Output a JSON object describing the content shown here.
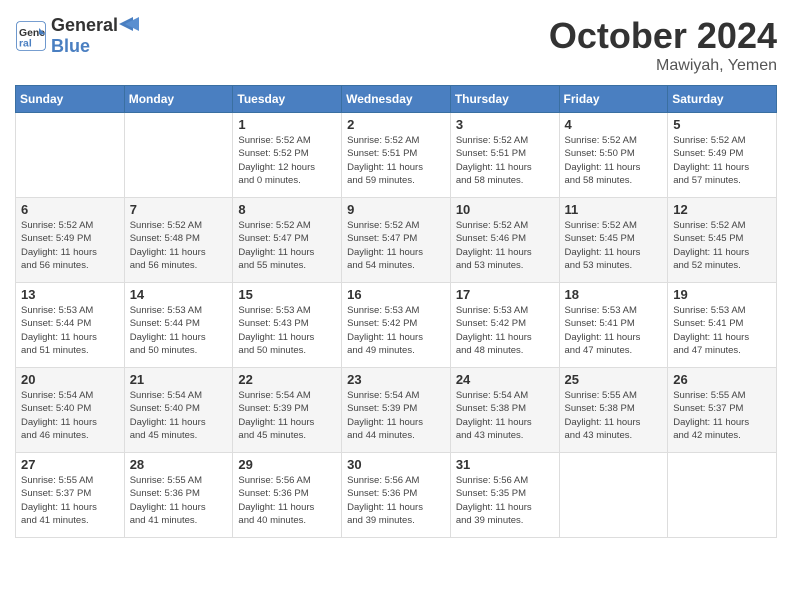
{
  "header": {
    "logo_line1": "General",
    "logo_line2": "Blue",
    "month_title": "October 2024",
    "location": "Mawiyah, Yemen"
  },
  "days_of_week": [
    "Sunday",
    "Monday",
    "Tuesday",
    "Wednesday",
    "Thursday",
    "Friday",
    "Saturday"
  ],
  "weeks": [
    [
      {
        "day": "",
        "info": ""
      },
      {
        "day": "",
        "info": ""
      },
      {
        "day": "1",
        "info": "Sunrise: 5:52 AM\nSunset: 5:52 PM\nDaylight: 12 hours\nand 0 minutes."
      },
      {
        "day": "2",
        "info": "Sunrise: 5:52 AM\nSunset: 5:51 PM\nDaylight: 11 hours\nand 59 minutes."
      },
      {
        "day": "3",
        "info": "Sunrise: 5:52 AM\nSunset: 5:51 PM\nDaylight: 11 hours\nand 58 minutes."
      },
      {
        "day": "4",
        "info": "Sunrise: 5:52 AM\nSunset: 5:50 PM\nDaylight: 11 hours\nand 58 minutes."
      },
      {
        "day": "5",
        "info": "Sunrise: 5:52 AM\nSunset: 5:49 PM\nDaylight: 11 hours\nand 57 minutes."
      }
    ],
    [
      {
        "day": "6",
        "info": "Sunrise: 5:52 AM\nSunset: 5:49 PM\nDaylight: 11 hours\nand 56 minutes."
      },
      {
        "day": "7",
        "info": "Sunrise: 5:52 AM\nSunset: 5:48 PM\nDaylight: 11 hours\nand 56 minutes."
      },
      {
        "day": "8",
        "info": "Sunrise: 5:52 AM\nSunset: 5:47 PM\nDaylight: 11 hours\nand 55 minutes."
      },
      {
        "day": "9",
        "info": "Sunrise: 5:52 AM\nSunset: 5:47 PM\nDaylight: 11 hours\nand 54 minutes."
      },
      {
        "day": "10",
        "info": "Sunrise: 5:52 AM\nSunset: 5:46 PM\nDaylight: 11 hours\nand 53 minutes."
      },
      {
        "day": "11",
        "info": "Sunrise: 5:52 AM\nSunset: 5:45 PM\nDaylight: 11 hours\nand 53 minutes."
      },
      {
        "day": "12",
        "info": "Sunrise: 5:52 AM\nSunset: 5:45 PM\nDaylight: 11 hours\nand 52 minutes."
      }
    ],
    [
      {
        "day": "13",
        "info": "Sunrise: 5:53 AM\nSunset: 5:44 PM\nDaylight: 11 hours\nand 51 minutes."
      },
      {
        "day": "14",
        "info": "Sunrise: 5:53 AM\nSunset: 5:44 PM\nDaylight: 11 hours\nand 50 minutes."
      },
      {
        "day": "15",
        "info": "Sunrise: 5:53 AM\nSunset: 5:43 PM\nDaylight: 11 hours\nand 50 minutes."
      },
      {
        "day": "16",
        "info": "Sunrise: 5:53 AM\nSunset: 5:42 PM\nDaylight: 11 hours\nand 49 minutes."
      },
      {
        "day": "17",
        "info": "Sunrise: 5:53 AM\nSunset: 5:42 PM\nDaylight: 11 hours\nand 48 minutes."
      },
      {
        "day": "18",
        "info": "Sunrise: 5:53 AM\nSunset: 5:41 PM\nDaylight: 11 hours\nand 47 minutes."
      },
      {
        "day": "19",
        "info": "Sunrise: 5:53 AM\nSunset: 5:41 PM\nDaylight: 11 hours\nand 47 minutes."
      }
    ],
    [
      {
        "day": "20",
        "info": "Sunrise: 5:54 AM\nSunset: 5:40 PM\nDaylight: 11 hours\nand 46 minutes."
      },
      {
        "day": "21",
        "info": "Sunrise: 5:54 AM\nSunset: 5:40 PM\nDaylight: 11 hours\nand 45 minutes."
      },
      {
        "day": "22",
        "info": "Sunrise: 5:54 AM\nSunset: 5:39 PM\nDaylight: 11 hours\nand 45 minutes."
      },
      {
        "day": "23",
        "info": "Sunrise: 5:54 AM\nSunset: 5:39 PM\nDaylight: 11 hours\nand 44 minutes."
      },
      {
        "day": "24",
        "info": "Sunrise: 5:54 AM\nSunset: 5:38 PM\nDaylight: 11 hours\nand 43 minutes."
      },
      {
        "day": "25",
        "info": "Sunrise: 5:55 AM\nSunset: 5:38 PM\nDaylight: 11 hours\nand 43 minutes."
      },
      {
        "day": "26",
        "info": "Sunrise: 5:55 AM\nSunset: 5:37 PM\nDaylight: 11 hours\nand 42 minutes."
      }
    ],
    [
      {
        "day": "27",
        "info": "Sunrise: 5:55 AM\nSunset: 5:37 PM\nDaylight: 11 hours\nand 41 minutes."
      },
      {
        "day": "28",
        "info": "Sunrise: 5:55 AM\nSunset: 5:36 PM\nDaylight: 11 hours\nand 41 minutes."
      },
      {
        "day": "29",
        "info": "Sunrise: 5:56 AM\nSunset: 5:36 PM\nDaylight: 11 hours\nand 40 minutes."
      },
      {
        "day": "30",
        "info": "Sunrise: 5:56 AM\nSunset: 5:36 PM\nDaylight: 11 hours\nand 39 minutes."
      },
      {
        "day": "31",
        "info": "Sunrise: 5:56 AM\nSunset: 5:35 PM\nDaylight: 11 hours\nand 39 minutes."
      },
      {
        "day": "",
        "info": ""
      },
      {
        "day": "",
        "info": ""
      }
    ]
  ]
}
